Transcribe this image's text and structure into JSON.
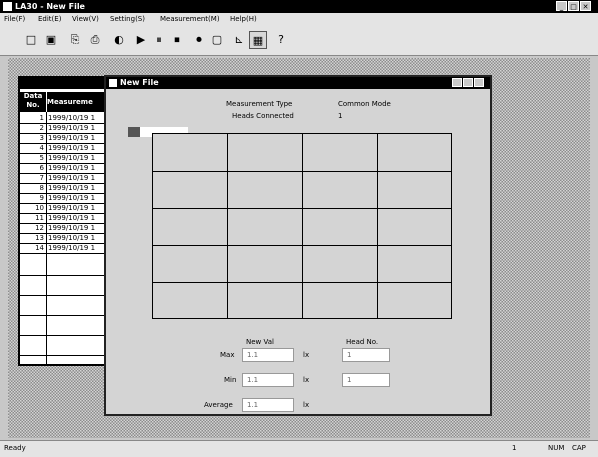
{
  "window": {
    "title": "LA30 - New File",
    "controls": [
      "_",
      "□",
      "✕"
    ]
  },
  "menu": [
    "File(F)",
    "Edit(E)",
    "View(V)",
    "Setting(S)",
    "Measurement(M)",
    "Help(H)"
  ],
  "toolbar": [
    {
      "name": "new-file",
      "glyph": "□"
    },
    {
      "name": "save",
      "glyph": "▣"
    },
    {
      "name": "copy",
      "glyph": "⎘"
    },
    {
      "name": "print",
      "glyph": "⎙"
    },
    {
      "name": "head",
      "glyph": "◐"
    },
    {
      "name": "play",
      "glyph": "▶"
    },
    {
      "name": "pause",
      "glyph": "⏸"
    },
    {
      "name": "stop",
      "glyph": "⏹"
    },
    {
      "name": "record",
      "glyph": "⏺"
    },
    {
      "name": "clear",
      "glyph": "▢"
    },
    {
      "name": "chart",
      "glyph": "⊾"
    },
    {
      "name": "table",
      "glyph": "▦"
    },
    {
      "name": "help",
      "glyph": "?"
    }
  ],
  "datatable": {
    "headers": [
      "Data No.",
      "Measureme"
    ],
    "rows": [
      {
        "no": "1",
        "ts": "1999/10/19 1"
      },
      {
        "no": "2",
        "ts": "1999/10/19 1"
      },
      {
        "no": "3",
        "ts": "1999/10/19 1"
      },
      {
        "no": "4",
        "ts": "1999/10/19 1"
      },
      {
        "no": "5",
        "ts": "1999/10/19 1"
      },
      {
        "no": "6",
        "ts": "1999/10/19 1"
      },
      {
        "no": "7",
        "ts": "1999/10/19 1"
      },
      {
        "no": "8",
        "ts": "1999/10/19 1"
      },
      {
        "no": "9",
        "ts": "1999/10/19 1"
      },
      {
        "no": "10",
        "ts": "1999/10/19 1"
      },
      {
        "no": "11",
        "ts": "1999/10/19 1"
      },
      {
        "no": "12",
        "ts": "1999/10/19 1"
      },
      {
        "no": "13",
        "ts": "1999/10/19 1"
      },
      {
        "no": "14",
        "ts": "1999/10/19 1"
      }
    ]
  },
  "newfile": {
    "title": "New File",
    "measurement_type_label": "Measurement Type",
    "measurement_type_value": "Common Mode",
    "heads_connected_label": "Heads Connected",
    "heads_connected_value": "1",
    "col_new_val": "New Val",
    "col_head_no": "Head No.",
    "stats": [
      {
        "label": "Max",
        "value": "1.1",
        "unit": "lx",
        "head": "1"
      },
      {
        "label": "Min",
        "value": "1.1",
        "unit": "lx",
        "head": "1"
      },
      {
        "label": "Average",
        "value": "1.1",
        "unit": "lx",
        "head": ""
      }
    ]
  },
  "status": {
    "left": "Ready",
    "mid": "1",
    "num": "NUM",
    "cap": "CAP"
  }
}
